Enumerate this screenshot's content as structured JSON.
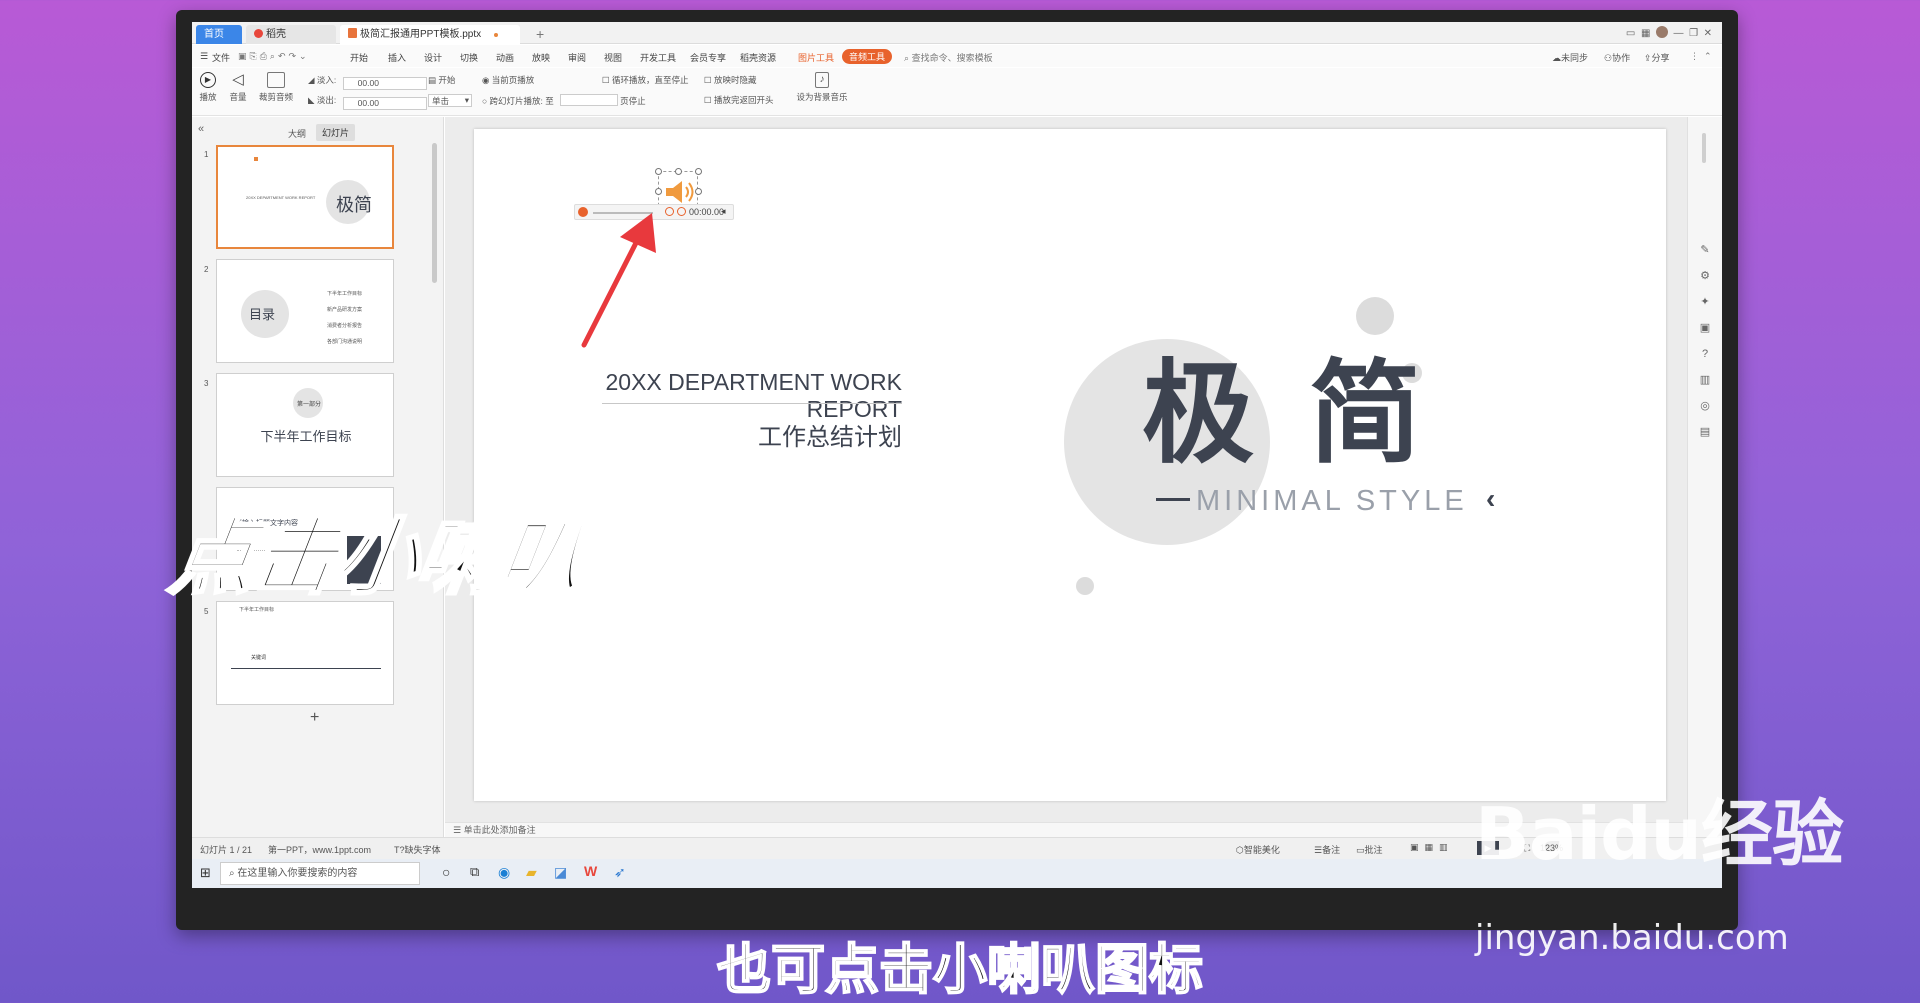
{
  "app": {
    "tabs": [
      "首页",
      "稻壳",
      "极简汇报通用PPT模板.pptx"
    ],
    "menu": [
      "文件",
      "开始",
      "插入",
      "设计",
      "切换",
      "动画",
      "放映",
      "审阅",
      "视图",
      "开发工具",
      "会员专享",
      "稻壳资源",
      "图片工具",
      "音频工具"
    ],
    "search_placeholder": "查找命令、搜索模板",
    "right_actions": [
      "未同步",
      "协作",
      "分享"
    ]
  },
  "ribbon": {
    "play": "播放",
    "volume": "音量",
    "trim": "裁剪音频",
    "fade_in_label": "淡入:",
    "fade_in_value": "00.00",
    "fade_out_label": "淡出:",
    "fade_out_value": "00.00",
    "start_label": "开始",
    "start_mode": "单击",
    "current_page": "当前页播放",
    "cross_slides": "跨幻灯片播放: 至",
    "page_stop": "页停止",
    "loop": "循环播放，直至停止",
    "hide_when_play": "放映时隐藏",
    "rewind": "播放完返回开头",
    "bg_music": "设为背景音乐"
  },
  "panel": {
    "tab_outline": "大纲",
    "tab_slides": "幻灯片",
    "thumbs": [
      {
        "num": "1",
        "title": "极简",
        "sub": "20XX DEPARTMENT WORK REPORT"
      },
      {
        "num": "2",
        "title": "目录",
        "items": [
          "下半年工作目标",
          "新产品研发方案",
          "消费者分析报告",
          "各部门沟通说明"
        ]
      },
      {
        "num": "3",
        "badge": "第一部分",
        "title": "下半年工作目标"
      },
      {
        "num": "4",
        "title": "请输入标题文字内容"
      },
      {
        "num": "5",
        "title": "下半年工作目标",
        "milestone": "关键词"
      }
    ],
    "add": "+"
  },
  "slide": {
    "report_en": "20XX DEPARTMENT WORK REPORT",
    "report_cn": "工作总结计划",
    "big_title": "极 简",
    "minimal": "MINIMAL STYLE",
    "audio_time": "00:00.00"
  },
  "notes_placeholder": "单击此处添加备注",
  "status": {
    "slide_count": "幻灯片 1 / 21",
    "theme": "第一PPT，www.1ppt.com",
    "missing_font": "缺失字体",
    "beautify": "智能美化",
    "notes": "备注",
    "comments": "批注",
    "zoom": "123%"
  },
  "taskbar": {
    "search": "在这里输入你要搜索的内容"
  },
  "overlay": {
    "caption": "点击小喇叭",
    "subtitle": "也可点击小喇叭图标",
    "watermark_logo": "Baidu经验",
    "watermark_url": "jingyan.baidu.com"
  },
  "colors": {
    "accent": "#e8622c",
    "title_gray": "#3d4350",
    "circle_gray": "#e4e4e4",
    "speaker": "#f09a3e",
    "arrow": "#e8393d"
  }
}
